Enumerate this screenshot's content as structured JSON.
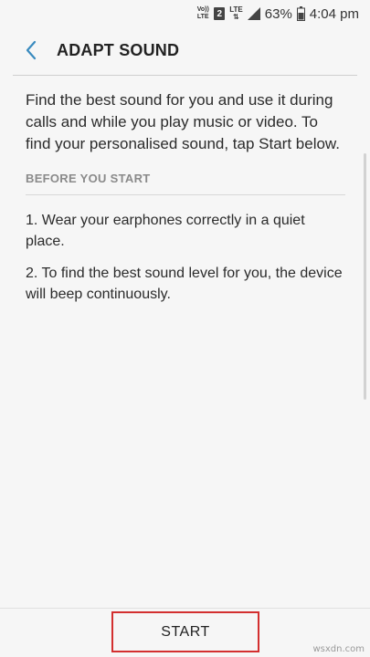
{
  "status_bar": {
    "volte_label": "Vo)) LTE",
    "sim_label": "2",
    "lte_label": "LTE",
    "battery_percent": "63%",
    "time": "4:04 pm"
  },
  "header": {
    "title": "ADAPT SOUND"
  },
  "content": {
    "intro": "Find the best sound for you and use it during calls and while you play music or video. To find your personalised sound, tap Start below.",
    "section_header": "BEFORE YOU START",
    "steps": [
      "1. Wear your earphones correctly in a quiet place.",
      "2. To find the best sound level for you, the device will beep continuously."
    ]
  },
  "footer": {
    "start_label": "START"
  },
  "watermark": "wsxdn.com",
  "colors": {
    "accent_back": "#3a8bbf",
    "highlight_border": "#d32f2f",
    "background": "#f6f6f6"
  }
}
